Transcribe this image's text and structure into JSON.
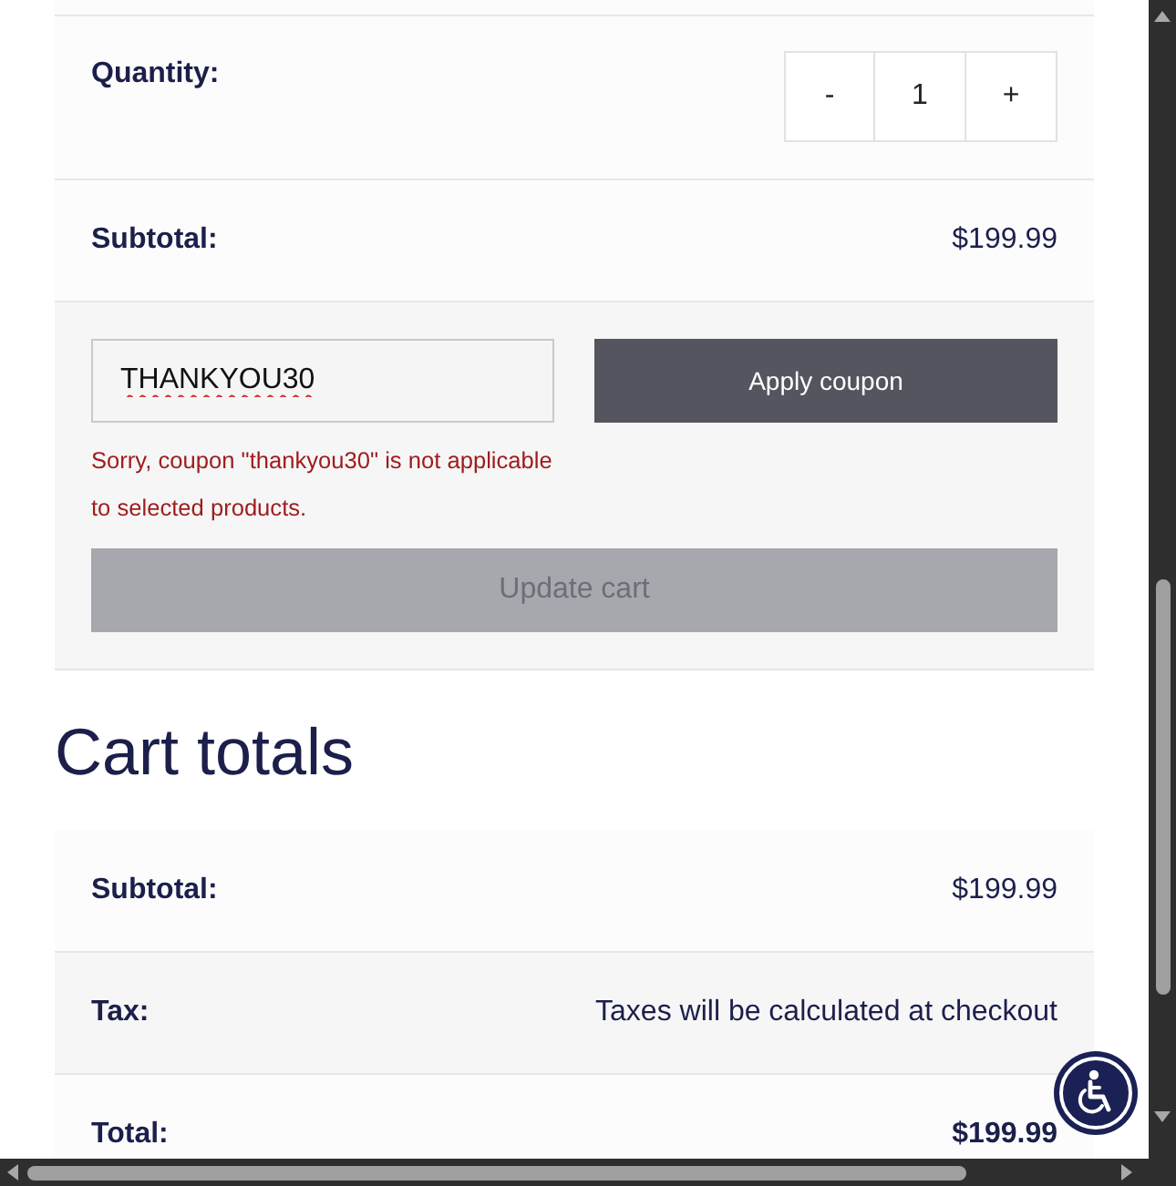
{
  "cart_item": {
    "quantity": {
      "label": "Quantity:",
      "decrement": "-",
      "value": "1",
      "increment": "+"
    },
    "subtotal": {
      "label": "Subtotal:",
      "value": "$199.99"
    }
  },
  "coupon": {
    "code": "THANKYOU30",
    "misspelled": true,
    "apply_button": {
      "label": "Apply coupon",
      "disabled": false
    },
    "error": "Sorry, coupon \"thankyou30\" is not applicable to selected products.",
    "update_button": {
      "label": "Update cart",
      "disabled": true
    }
  },
  "cart_totals": {
    "title": "Cart totals",
    "rows": [
      {
        "kind": "line",
        "label": "Subtotal:",
        "value": "$199.99"
      },
      {
        "kind": "line",
        "label": "Tax:",
        "value": "Taxes will be calculated at checkout"
      },
      {
        "kind": "total",
        "label": "Total:",
        "value": "$199.99"
      }
    ]
  }
}
